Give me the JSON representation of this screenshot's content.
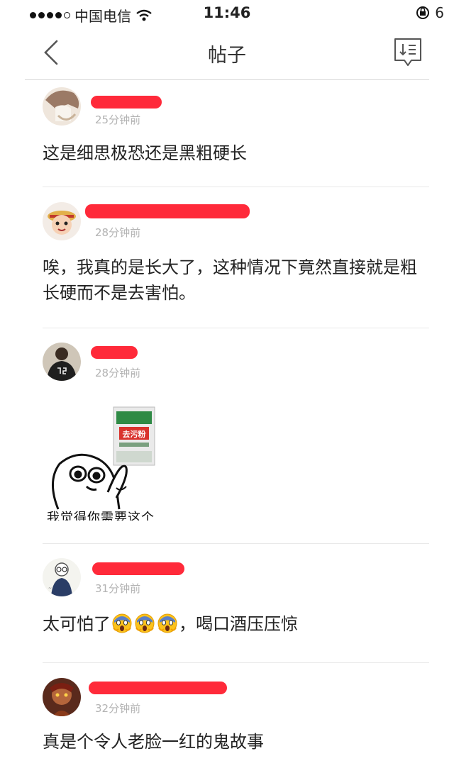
{
  "status_bar": {
    "carrier": "中国电信",
    "time": "11:46",
    "battery_label": "6"
  },
  "nav": {
    "title": "帖子"
  },
  "comments": [
    {
      "time": "25分钟前",
      "text": "这是细思极恐还是黑粗硬长"
    },
    {
      "time": "28分钟前",
      "text": "唉，我真的是长大了，这种情况下竟然直接就是粗长硬而不是去害怕。"
    },
    {
      "time": "28分钟前",
      "text": "",
      "meme_caption": "我觉得你需要这个",
      "meme_package_label": "去污粉"
    },
    {
      "time": "31分钟前",
      "text_before": "太可怕了",
      "text_after": "，喝口酒压压惊",
      "emoji_count": 3
    },
    {
      "time": "32分钟前",
      "text": "真是个令人老脸一红的鬼故事"
    }
  ],
  "colors": {
    "redaction": "#ff2a3a",
    "meta": "#b3b3b3",
    "divider": "#e8e8e8"
  }
}
